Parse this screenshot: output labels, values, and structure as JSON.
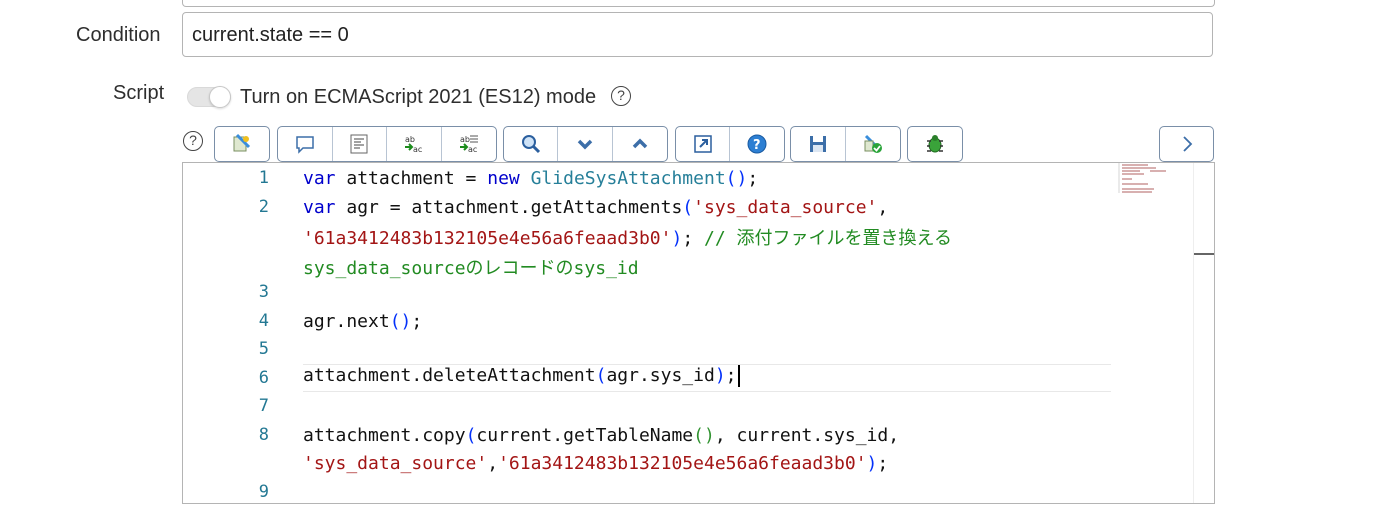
{
  "form": {
    "condition_label": "Condition",
    "condition_value": "current.state == 0",
    "script_label": "Script",
    "es_toggle_label": "Turn on ECMAScript 2021 (ES12) mode",
    "help_glyph": "?"
  },
  "toolbar": {
    "icons": [
      "script-include-icon",
      "comment-icon",
      "format-code-icon",
      "replace-icon",
      "replace-all-icon",
      "search-icon",
      "find-next-icon",
      "find-previous-icon",
      "fullscreen-icon",
      "help-icon",
      "save-icon",
      "syntax-check-icon",
      "debug-icon",
      "expand-right-icon"
    ]
  },
  "editor": {
    "lines": [
      {
        "num": "1"
      },
      {
        "num": "2"
      },
      {
        "num": "3"
      },
      {
        "num": "4"
      },
      {
        "num": "5"
      },
      {
        "num": "6"
      },
      {
        "num": "7"
      },
      {
        "num": "8"
      },
      {
        "num": "9"
      }
    ],
    "tokens": {
      "l1": [
        "var",
        " attachment = ",
        "new",
        " ",
        "GlideSysAttachment",
        "()",
        ";"
      ],
      "l2a": [
        "var",
        " agr = attachment.getAttachments",
        "(",
        "'sys_data_source'",
        ","
      ],
      "l2b": [
        "'61a3412483b132105e4e56a6feaad3b0'",
        ")",
        "; ",
        "// 添付ファイルを置き換える"
      ],
      "l2c": [
        "sys_data_sourceのレコードのsys_id"
      ],
      "l4": [
        "agr.next",
        "()",
        ";"
      ],
      "l6": [
        "attachment.deleteAttachment",
        "(",
        "agr.sys_id",
        ")",
        ";"
      ],
      "l8a": [
        "attachment.copy",
        "(",
        "current.getTableName",
        "()",
        ", current.sys_id,"
      ],
      "l8b": [
        "'sys_data_source'",
        ",",
        "'61a3412483b132105e4e56a6feaad3b0'",
        ")",
        ";"
      ]
    }
  },
  "colors": {
    "keyword": "#0000cc",
    "class": "#267f99",
    "string": "#a31515",
    "comment": "#228b22",
    "line_number": "#237893"
  }
}
